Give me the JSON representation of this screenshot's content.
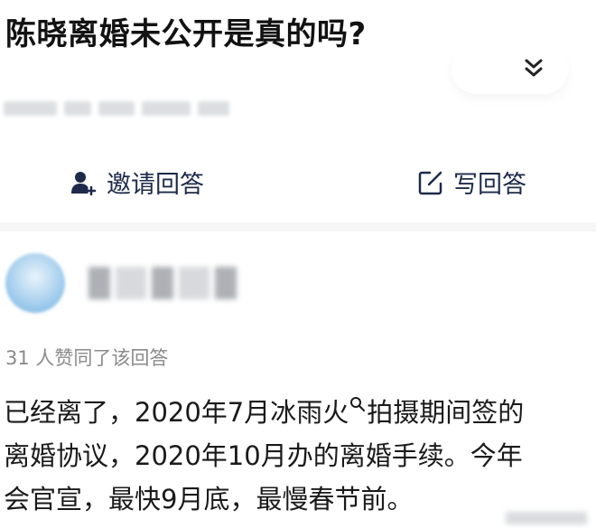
{
  "question": {
    "title": "陈晓离婚未公开是真的吗?",
    "expand_icon": "double-chevron-down-icon"
  },
  "actions": {
    "invite_label": "邀请回答",
    "invite_icon": "person-add-icon",
    "write_label": "写回答",
    "write_icon": "edit-square-icon"
  },
  "answer": {
    "endorse_text": "31 人赞同了该回答",
    "line1_a": "已经离了，2020年7月冰雨火",
    "line1_b": "拍摄期间签的",
    "line2": "离婚协议，2020年10月办的离婚手续。今年",
    "line3": "会官宣，最快9月底，最慢春节前。",
    "inline_icon": "search-icon"
  },
  "colors": {
    "accent": "#1e2a4a",
    "muted": "#8a8a8a"
  }
}
